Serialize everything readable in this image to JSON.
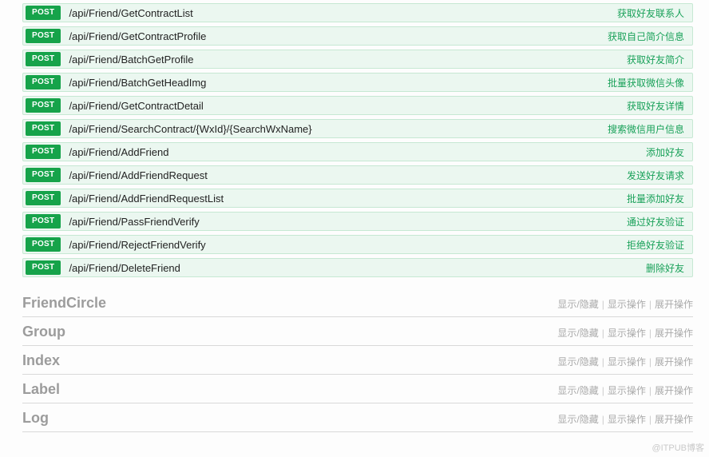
{
  "endpoints": [
    {
      "method": "POST",
      "path": "/api/Friend/GetContractList",
      "desc": "获取好友联系人"
    },
    {
      "method": "POST",
      "path": "/api/Friend/GetContractProfile",
      "desc": "获取自己简介信息"
    },
    {
      "method": "POST",
      "path": "/api/Friend/BatchGetProfile",
      "desc": "获取好友简介"
    },
    {
      "method": "POST",
      "path": "/api/Friend/BatchGetHeadImg",
      "desc": "批量获取微信头像"
    },
    {
      "method": "POST",
      "path": "/api/Friend/GetContractDetail",
      "desc": "获取好友详情"
    },
    {
      "method": "POST",
      "path": "/api/Friend/SearchContract/{WxId}/{SearchWxName}",
      "desc": "搜索微信用户信息"
    },
    {
      "method": "POST",
      "path": "/api/Friend/AddFriend",
      "desc": "添加好友"
    },
    {
      "method": "POST",
      "path": "/api/Friend/AddFriendRequest",
      "desc": "发送好友请求"
    },
    {
      "method": "POST",
      "path": "/api/Friend/AddFriendRequestList",
      "desc": "批量添加好友"
    },
    {
      "method": "POST",
      "path": "/api/Friend/PassFriendVerify",
      "desc": "通过好友验证"
    },
    {
      "method": "POST",
      "path": "/api/Friend/RejectFriendVerify",
      "desc": "拒绝好友验证"
    },
    {
      "method": "POST",
      "path": "/api/Friend/DeleteFriend",
      "desc": "删除好友"
    }
  ],
  "sections": [
    {
      "name": "FriendCircle"
    },
    {
      "name": "Group"
    },
    {
      "name": "Index"
    },
    {
      "name": "Label"
    },
    {
      "name": "Log"
    }
  ],
  "actions": {
    "toggle": "显示/隐藏",
    "listOps": "显示操作",
    "expand": "展开操作"
  },
  "watermark": "@ITPUB博客"
}
